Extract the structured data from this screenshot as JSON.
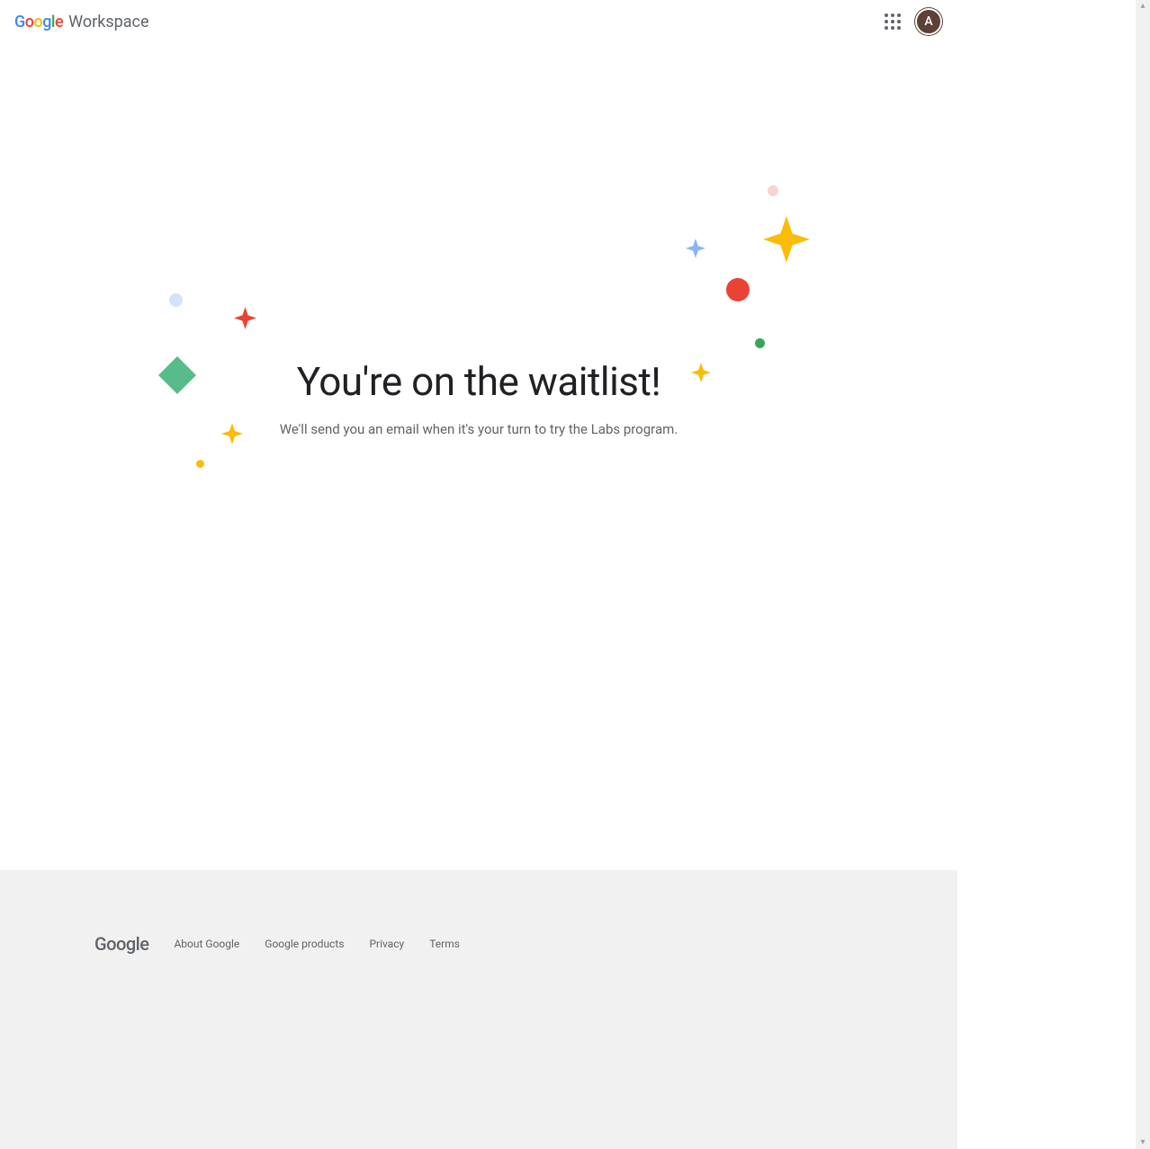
{
  "header": {
    "product_suffix": "Workspace",
    "avatar_initial": "A"
  },
  "hero": {
    "title": "You're on the waitlist!",
    "subtitle": "We'll send you an email when it's your turn to try the Labs program."
  },
  "footer": {
    "logo": "Google",
    "links": [
      "About Google",
      "Google products",
      "Privacy",
      "Terms"
    ]
  }
}
